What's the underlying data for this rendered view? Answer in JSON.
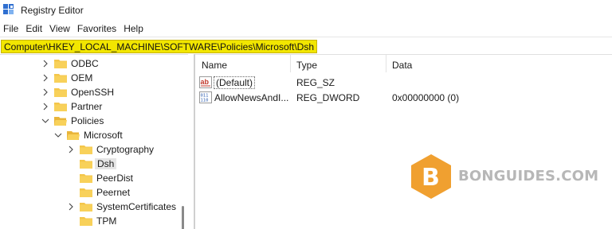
{
  "window": {
    "title": "Registry Editor",
    "app_icon": "regedit-icon"
  },
  "menu": {
    "items": [
      "File",
      "Edit",
      "View",
      "Favorites",
      "Help"
    ]
  },
  "address": {
    "path": "Computer\\HKEY_LOCAL_MACHINE\\SOFTWARE\\Policies\\Microsoft\\Dsh",
    "highlight_color": "#f2e600"
  },
  "tree": {
    "items": [
      {
        "label": "ODBC",
        "expanded": false
      },
      {
        "label": "OEM",
        "expanded": false
      },
      {
        "label": "OpenSSH",
        "expanded": false
      },
      {
        "label": "Partner",
        "expanded": false
      },
      {
        "label": "Policies",
        "expanded": true
      },
      {
        "label": "Microsoft",
        "expanded": true
      },
      {
        "label": "Cryptography",
        "expanded": false
      },
      {
        "label": "Dsh",
        "selected": true
      },
      {
        "label": "PeerDist"
      },
      {
        "label": "Peernet"
      },
      {
        "label": "SystemCertificates",
        "expanded": false
      },
      {
        "label": "TPM"
      }
    ]
  },
  "values": {
    "columns": {
      "name": "Name",
      "type": "Type",
      "data": "Data"
    },
    "rows": [
      {
        "name": "(Default)",
        "type": "REG_SZ",
        "data": "",
        "icon": "string-value-icon"
      },
      {
        "name": "AllowNewsAndI...",
        "type": "REG_DWORD",
        "data": "0x00000000 (0)",
        "icon": "binary-value-icon"
      }
    ]
  },
  "watermark": {
    "letter": "B",
    "text": "BONGUIDES.COM",
    "hex_color": "#f0a030"
  }
}
